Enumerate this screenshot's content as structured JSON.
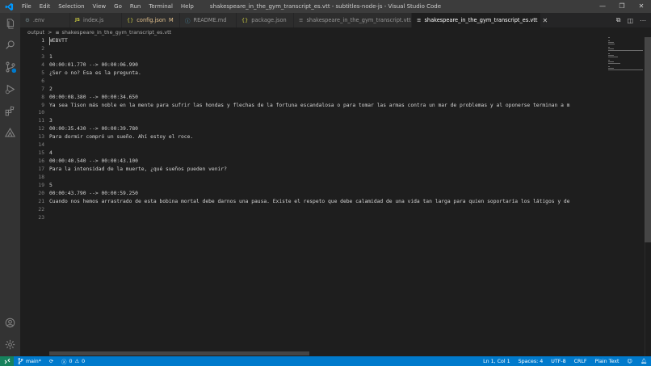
{
  "window": {
    "title": "shakespeare_in_the_gym_transcript_es.vtt - subtitles-node-js - Visual Studio Code",
    "menu": [
      "File",
      "Edit",
      "Selection",
      "View",
      "Go",
      "Run",
      "Terminal",
      "Help"
    ]
  },
  "tabs": [
    {
      "label": ".env",
      "icon": "gear-icon",
      "icon_glyph": "⚙",
      "icon_color": "#6d8086",
      "modified": false,
      "active": false
    },
    {
      "label": "index.js",
      "icon": "js-icon",
      "icon_glyph": "JS",
      "icon_color": "#cbcb41",
      "modified": false,
      "active": false
    },
    {
      "label": "config.json",
      "icon": "json-icon",
      "icon_glyph": "{}",
      "icon_color": "#cbcb41",
      "modified": true,
      "mod_badge": "M",
      "active": false
    },
    {
      "label": "README.md",
      "icon": "info-icon",
      "icon_glyph": "ⓘ",
      "icon_color": "#519aba",
      "modified": false,
      "active": false
    },
    {
      "label": "package.json",
      "icon": "json-icon",
      "icon_glyph": "{}",
      "icon_color": "#cbcb41",
      "modified": false,
      "active": false
    },
    {
      "label": "shakespeare_in_the_gym_transcript.vtt",
      "icon": "lines-icon",
      "icon_glyph": "≡",
      "icon_color": "#c5c5c5",
      "modified": false,
      "active": false
    },
    {
      "label": "shakespeare_in_the_gym_transcript_es.vtt",
      "icon": "lines-icon",
      "icon_glyph": "≡",
      "icon_color": "#c5c5c5",
      "modified": false,
      "active": true
    }
  ],
  "breadcrumb": {
    "folder": "output",
    "separator": ">",
    "file": "shakespeare_in_the_gym_transcript_es.vtt"
  },
  "editor": {
    "line_numbers": [
      "1",
      "2",
      "3",
      "4",
      "5",
      "6",
      "7",
      "8",
      "9",
      "10",
      "11",
      "12",
      "13",
      "14",
      "15",
      "16",
      "17",
      "18",
      "19",
      "20",
      "21",
      "22",
      "23"
    ],
    "current_line": 1,
    "lines": [
      "WEBVTT",
      "",
      "1",
      "00:00:01.770 --> 00:00:06.990",
      "¿Ser o no? Esa es la pregunta.",
      "",
      "2",
      "00:00:08.380 --> 00:00:34.650",
      "Ya sea Tison más noble en la mente para sufrir las hondas y flechas de la fortuna escandalosa o para tomar las armas contra un mar de problemas y al oponerse terminan a m",
      "",
      "3",
      "00:00:35.430 --> 00:00:39.780",
      "Para dormir compró un sueño. Ahí estoy el roce.",
      "",
      "4",
      "00:00:40.540 --> 00:00:43.100",
      "Para la intensidad de la muerte, ¿qué sueños pueden venir?",
      "",
      "5",
      "00:00:43.790 --> 00:00:59.250",
      "Cuando nos hemos arrastrado de esta bobina mortal debe darnos una pausa. Existe el respeto que debe calamidad de una vida tan larga para quien soportaría los látigos y de",
      "",
      ""
    ]
  },
  "statusbar": {
    "branch": "main*",
    "errors": "0",
    "warnings": "0",
    "cursor": "Ln 1, Col 1",
    "spaces": "Spaces: 4",
    "encoding": "UTF-8",
    "eol": "CRLF",
    "language": "Plain Text"
  },
  "colors": {
    "titlebar": "#3c3c3c",
    "activitybar": "#333333",
    "editor_bg": "#1e1e1e",
    "statusbar": "#007acc",
    "remote": "#16825d",
    "modified": "#e2c08d"
  }
}
